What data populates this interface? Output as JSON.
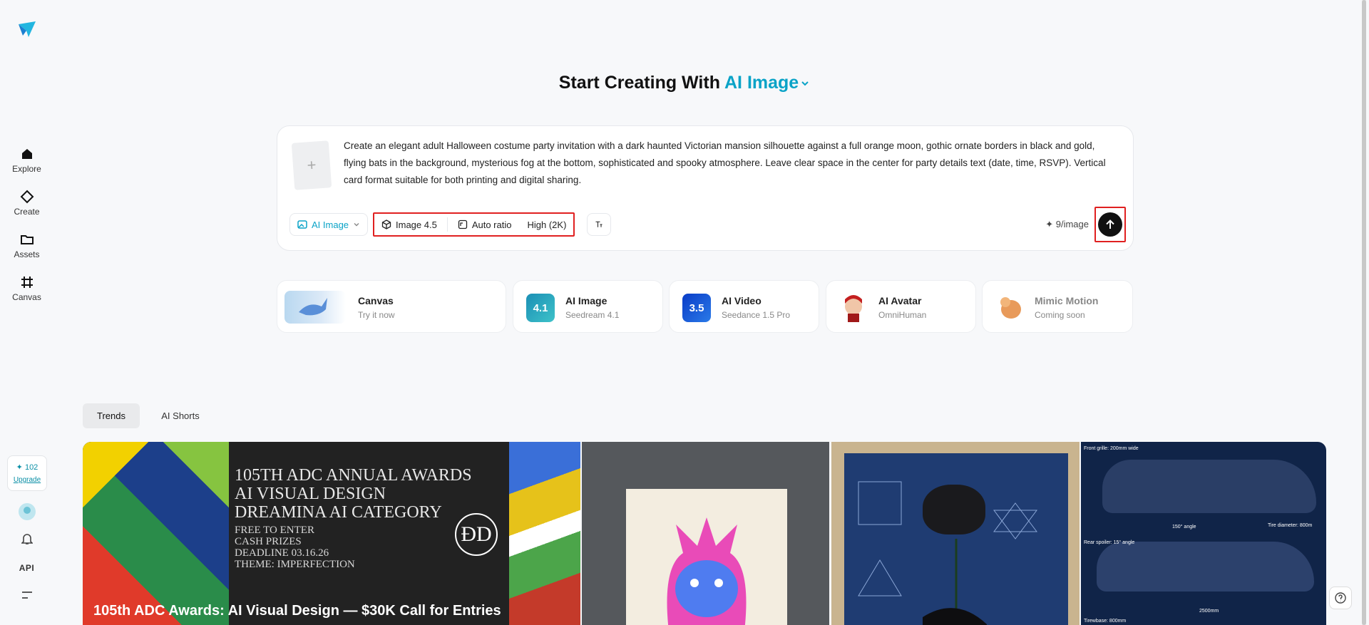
{
  "sidebar": {
    "items": [
      {
        "label": "Explore"
      },
      {
        "label": "Create"
      },
      {
        "label": "Assets"
      },
      {
        "label": "Canvas"
      }
    ],
    "credits": "✦ 102",
    "upgrade": "Upgrade",
    "api": "API"
  },
  "heading": {
    "prefix": "Start Creating With",
    "accent": "AI Image"
  },
  "prompt": {
    "text": "Create an elegant adult Halloween costume party invitation with a dark haunted Victorian mansion silhouette against a full orange moon, gothic ornate borders in black and gold, flying bats in the background, mysterious fog at the bottom, sophisticated and spooky atmosphere. Leave clear space in the center for party details text (date, time, RSVP). Vertical card format suitable for both printing and digital sharing.",
    "mode": "AI Image",
    "model": "Image 4.5",
    "ratio": "Auto ratio",
    "quality": "High (2K)",
    "cost": "✦ 9/image"
  },
  "tools": [
    {
      "title": "Canvas",
      "sub": "Try it now"
    },
    {
      "title": "AI Image",
      "sub": "Seedream 4.1",
      "badge": "4.1"
    },
    {
      "title": "AI Video",
      "sub": "Seedance 1.5 Pro",
      "badge": "3.5"
    },
    {
      "title": "AI Avatar",
      "sub": "OmniHuman"
    },
    {
      "title": "Mimic Motion",
      "sub": "Coming soon"
    }
  ],
  "tabs": [
    {
      "label": "Trends"
    },
    {
      "label": "AI Shorts"
    }
  ],
  "gallery": {
    "feature_lines": [
      "105TH ADC ANNUAL AWARDS",
      "AI VISUAL DESIGN",
      "DREAMINA AI CATEGORY"
    ],
    "feature_small": [
      "FREE TO ENTER",
      "CASH PRIZES",
      "DEADLINE 03.16.26",
      "THEME: IMPERFECTION"
    ],
    "feature_caption": "105th ADC Awards: AI Visual Design — $30K Call for Entries",
    "car_notes": [
      "Front grille: 200mm wide",
      "150° angle",
      "Tire diameter: 800m",
      "Rear spoiler: 15° angle",
      "2500mm",
      "Tirewbase: 800mm"
    ]
  },
  "colors": {
    "accent": "#0aa3c7",
    "highlight": "#e02020"
  }
}
